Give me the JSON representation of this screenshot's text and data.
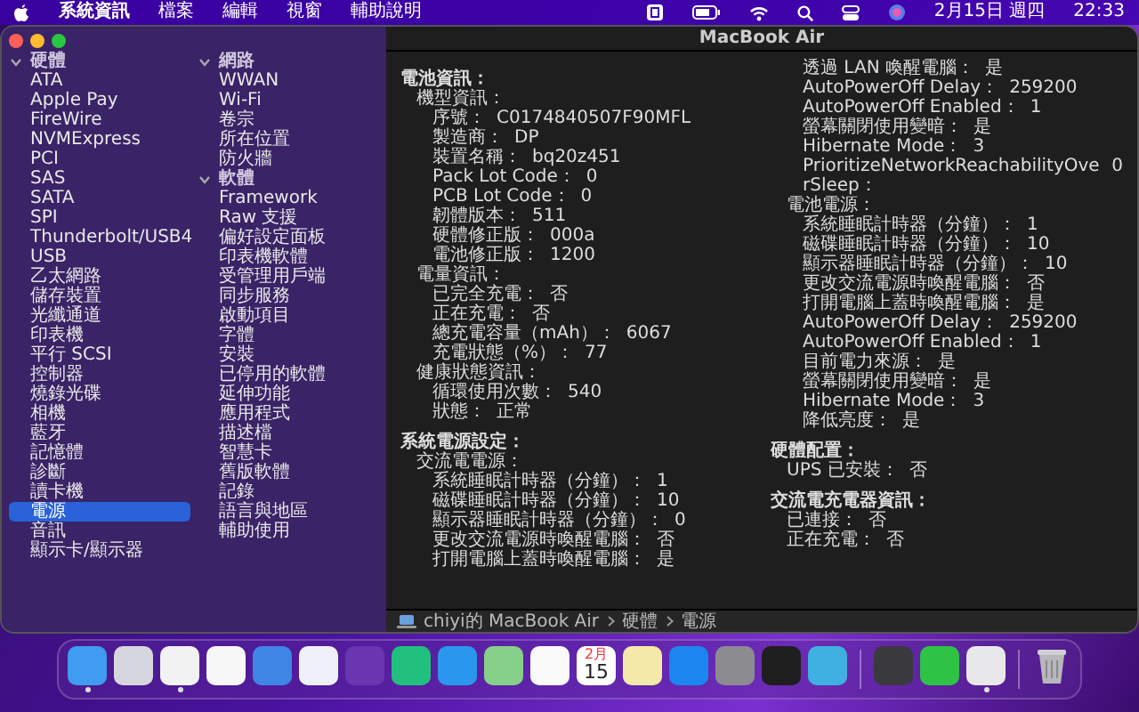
{
  "menu_bar": {
    "app_name": "系統資訊",
    "menus": [
      "檔案",
      "編輯",
      "視窗",
      "輔助說明"
    ],
    "date": "2月15日 週四",
    "time": "22:33"
  },
  "window": {
    "title": "MacBook Air"
  },
  "sidebar": {
    "sections": [
      {
        "label": "硬體",
        "expanded": true,
        "items": [
          {
            "label": "ATA",
            "selected": false
          },
          {
            "label": "Apple Pay",
            "selected": false
          },
          {
            "label": "FireWire",
            "selected": false
          },
          {
            "label": "NVMExpress",
            "selected": false
          },
          {
            "label": "PCI",
            "selected": false
          },
          {
            "label": "SAS",
            "selected": false
          },
          {
            "label": "SATA",
            "selected": false
          },
          {
            "label": "SPI",
            "selected": false
          },
          {
            "label": "Thunderbolt/USB4",
            "selected": false
          },
          {
            "label": "USB",
            "selected": false
          },
          {
            "label": "乙太網路",
            "selected": false
          },
          {
            "label": "儲存裝置",
            "selected": false
          },
          {
            "label": "光纖通道",
            "selected": false
          },
          {
            "label": "印表機",
            "selected": false
          },
          {
            "label": "平行 SCSI",
            "selected": false
          },
          {
            "label": "控制器",
            "selected": false
          },
          {
            "label": "燒錄光碟",
            "selected": false
          },
          {
            "label": "相機",
            "selected": false
          },
          {
            "label": "藍牙",
            "selected": false
          },
          {
            "label": "記憶體",
            "selected": false
          },
          {
            "label": "診斷",
            "selected": false
          },
          {
            "label": "讀卡機",
            "selected": false
          },
          {
            "label": "電源",
            "selected": true
          },
          {
            "label": "音訊",
            "selected": false
          },
          {
            "label": "顯示卡/顯示器",
            "selected": false
          }
        ]
      },
      {
        "label": "網路",
        "expanded": true,
        "items": [
          {
            "label": "WWAN",
            "selected": false
          },
          {
            "label": "Wi-Fi",
            "selected": false
          },
          {
            "label": "卷宗",
            "selected": false
          },
          {
            "label": "所在位置",
            "selected": false
          },
          {
            "label": "防火牆",
            "selected": false
          }
        ]
      },
      {
        "label": "軟體",
        "expanded": true,
        "items": [
          {
            "label": "Framework",
            "selected": false
          },
          {
            "label": "Raw 支援",
            "selected": false
          },
          {
            "label": "偏好設定面板",
            "selected": false
          },
          {
            "label": "印表機軟體",
            "selected": false
          },
          {
            "label": "受管理用戶端",
            "selected": false
          },
          {
            "label": "同步服務",
            "selected": false
          },
          {
            "label": "啟動項目",
            "selected": false
          },
          {
            "label": "字體",
            "selected": false
          },
          {
            "label": "安裝",
            "selected": false
          },
          {
            "label": "已停用的軟體",
            "selected": false
          },
          {
            "label": "延伸功能",
            "selected": false
          },
          {
            "label": "應用程式",
            "selected": false
          },
          {
            "label": "描述檔",
            "selected": false
          },
          {
            "label": "智慧卡",
            "selected": false
          },
          {
            "label": "舊版軟體",
            "selected": false
          },
          {
            "label": "記錄",
            "selected": false
          },
          {
            "label": "語言與地區",
            "selected": false
          },
          {
            "label": "輔助使用",
            "selected": false
          }
        ]
      }
    ]
  },
  "report": [
    {
      "label": "電池資訊：",
      "children": [
        {
          "label": "機型資訊：",
          "children": [
            {
              "label": "序號：",
              "value": "C0174840507F90MFL"
            },
            {
              "label": "製造商：",
              "value": "DP"
            },
            {
              "label": "裝置名稱：",
              "value": "bq20z451"
            },
            {
              "label": "Pack Lot Code：",
              "value": "0"
            },
            {
              "label": "PCB Lot Code：",
              "value": "0"
            },
            {
              "label": "韌體版本：",
              "value": "511"
            },
            {
              "label": "硬體修正版：",
              "value": "000a"
            },
            {
              "label": "電池修正版：",
              "value": "1200"
            }
          ]
        },
        {
          "label": "電量資訊：",
          "children": [
            {
              "label": "已完全充電：",
              "value": "否"
            },
            {
              "label": "正在充電：",
              "value": "否"
            },
            {
              "label": "總充電容量（mAh）：",
              "value": "6067"
            },
            {
              "label": "充電狀態（%）：",
              "value": "77"
            }
          ]
        },
        {
          "label": "健康狀態資訊：",
          "children": [
            {
              "label": "循環使用次數：",
              "value": "540"
            },
            {
              "label": "狀態：",
              "value": "正常"
            }
          ]
        }
      ]
    },
    {
      "label": "系統電源設定：",
      "children": [
        {
          "label": "交流電電源：",
          "children": [
            {
              "label": "系統睡眠計時器（分鐘）：",
              "value": "1"
            },
            {
              "label": "磁碟睡眠計時器（分鐘）：",
              "value": "10"
            },
            {
              "label": "顯示器睡眠計時器（分鐘）：",
              "value": "0"
            },
            {
              "label": "更改交流電源時喚醒電腦：",
              "value": "否"
            },
            {
              "label": "打開電腦上蓋時喚醒電腦：",
              "value": "是"
            },
            {
              "label": "透過 LAN 喚醒電腦：",
              "value": "是"
            },
            {
              "label": "AutoPowerOff Delay：",
              "value": "259200"
            },
            {
              "label": "AutoPowerOff Enabled：",
              "value": "1"
            },
            {
              "label": "螢幕關閉使用變暗：",
              "value": "是"
            },
            {
              "label": "Hibernate Mode：",
              "value": "3"
            },
            {
              "label": "PrioritizeNetworkReachabilityOverSleep：",
              "value": "0"
            }
          ]
        },
        {
          "label": "電池電源：",
          "children": [
            {
              "label": "系統睡眠計時器（分鐘）：",
              "value": "1"
            },
            {
              "label": "磁碟睡眠計時器（分鐘）：",
              "value": "10"
            },
            {
              "label": "顯示器睡眠計時器（分鐘）：",
              "value": "10"
            },
            {
              "label": "更改交流電源時喚醒電腦：",
              "value": "否"
            },
            {
              "label": "打開電腦上蓋時喚醒電腦：",
              "value": "是"
            },
            {
              "label": "AutoPowerOff Delay：",
              "value": "259200"
            },
            {
              "label": "AutoPowerOff Enabled：",
              "value": "1"
            },
            {
              "label": "目前電力來源：",
              "value": "是"
            },
            {
              "label": "螢幕關閉使用變暗：",
              "value": "是"
            },
            {
              "label": "Hibernate Mode：",
              "value": "3"
            },
            {
              "label": "降低亮度：",
              "value": "是"
            }
          ]
        }
      ]
    },
    {
      "label": "硬體配置：",
      "children": [
        {
          "label": "UPS 已安裝：",
          "value": "否"
        }
      ]
    },
    {
      "label": "交流電充電器資訊：",
      "children": [
        {
          "label": "已連接：",
          "value": "否"
        },
        {
          "label": "正在充電：",
          "value": "否"
        }
      ]
    }
  ],
  "breadcrumb": [
    "chiyi的 MacBook Air",
    "硬體",
    "電源"
  ],
  "dock": {
    "groups": [
      {
        "apps": [
          {
            "kind": "app",
            "color": "#3f9cf0",
            "running": true
          },
          {
            "kind": "app",
            "color": "#d6d6de",
            "running": false
          },
          {
            "kind": "app",
            "color": "#f2f2f2",
            "running": true
          },
          {
            "kind": "app",
            "color": "#f7f7f7",
            "running": false
          },
          {
            "kind": "app",
            "color": "#3d86e6",
            "running": false
          },
          {
            "kind": "app",
            "color": "#eef2f8",
            "running": false
          },
          {
            "kind": "app",
            "color": "#6a35b0",
            "running": false
          },
          {
            "kind": "app",
            "color": "#22c07e",
            "running": false
          },
          {
            "kind": "app",
            "color": "#2a96ee",
            "running": false
          },
          {
            "kind": "app",
            "color": "#86d08a",
            "running": false
          },
          {
            "kind": "app",
            "color": "#fafafa",
            "running": false
          },
          {
            "kind": "calendar",
            "month": "2月",
            "day": "15",
            "running": false
          },
          {
            "kind": "app",
            "color": "#f4e9a8",
            "running": false
          },
          {
            "kind": "app",
            "color": "#1c86ef",
            "running": false
          },
          {
            "kind": "app",
            "color": "#8c8c90",
            "running": false
          },
          {
            "kind": "app",
            "color": "#1e1e1e",
            "running": false
          },
          {
            "kind": "app",
            "color": "#3fb0e0",
            "running": false
          }
        ]
      },
      {
        "apps": [
          {
            "kind": "app",
            "color": "#3a3a3e",
            "running": false
          },
          {
            "kind": "app",
            "color": "#2fc345",
            "running": false
          },
          {
            "kind": "app",
            "color": "#e8e8ea",
            "running": true
          }
        ]
      },
      {
        "apps": [
          {
            "kind": "trash",
            "running": false
          }
        ]
      }
    ]
  }
}
